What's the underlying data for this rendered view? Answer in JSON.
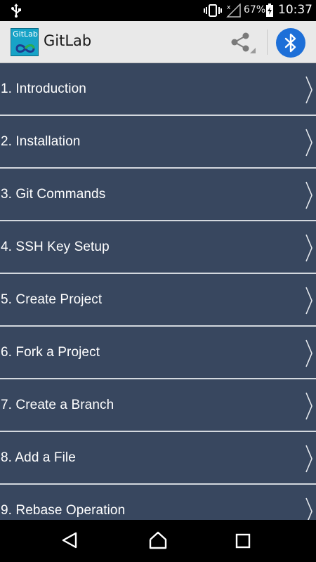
{
  "status_bar": {
    "battery_percent": "67%",
    "time": "10:37",
    "icons": [
      "usb-icon",
      "vibrate-icon",
      "signal-icon",
      "battery-icon"
    ]
  },
  "app_bar": {
    "logo_text": "GitLab",
    "title": "GitLab",
    "actions": [
      "share-icon",
      "bluetooth-icon"
    ]
  },
  "menu": {
    "items": [
      {
        "label": "1. Introduction"
      },
      {
        "label": "2. Installation"
      },
      {
        "label": "3. Git Commands"
      },
      {
        "label": "4. SSH Key Setup"
      },
      {
        "label": "5. Create Project"
      },
      {
        "label": "6. Fork a Project"
      },
      {
        "label": "7. Create a Branch"
      },
      {
        "label": "8. Add a File"
      },
      {
        "label": "9. Rebase Operation"
      }
    ]
  },
  "nav_bar": {
    "buttons": [
      "back-icon",
      "home-icon",
      "recents-icon"
    ]
  },
  "colors": {
    "list_background": "#38475f",
    "divider": "#d3d8de",
    "app_bar": "#e9e9e9",
    "bluetooth_accent": "#1d6fd8",
    "logo_background": "#17a3c7"
  }
}
